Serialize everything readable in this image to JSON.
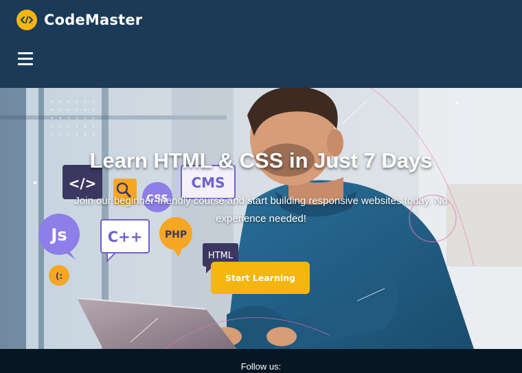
{
  "brand": {
    "name": "CodeMaster",
    "logo_icon": "code-brackets-icon",
    "logo_color": "#f5b50f"
  },
  "nav": {
    "menu_icon": "hamburger-menu-icon"
  },
  "hero": {
    "title": "Learn HTML & CSS in Just 7 Days",
    "description": "Join our beginner-friendly course and start building responsive websites today. No experience needed!",
    "cta_label": "Start Learning",
    "cta_color": "#f5b50f",
    "illustration_labels": [
      "</>",
      "CSS",
      "CMS",
      "Js",
      "C++",
      "PHP",
      "HTML",
      "(:"
    ]
  },
  "footer": {
    "follow_label": "Follow us:"
  },
  "colors": {
    "header_bg": "#1a3a57",
    "footer_bg": "#061622"
  }
}
